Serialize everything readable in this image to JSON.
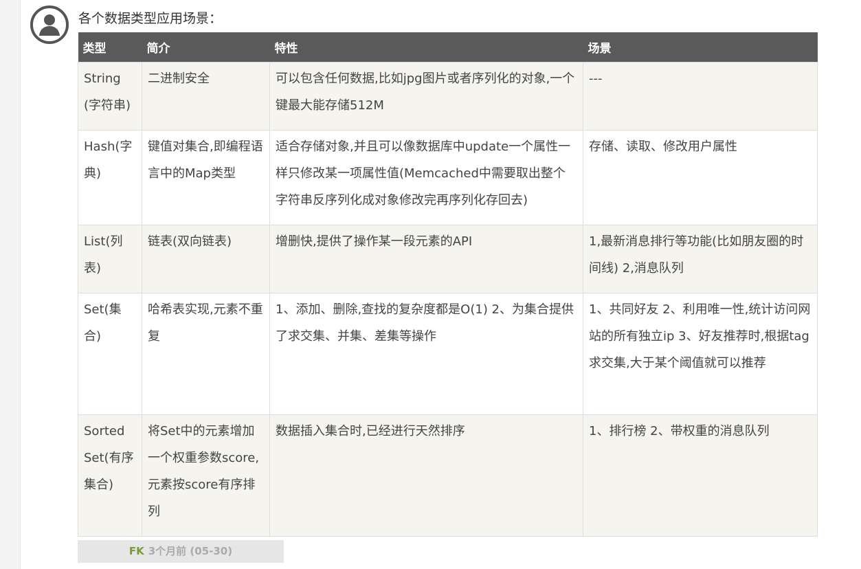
{
  "post": {
    "intro": "各个数据类型应用场景：",
    "avatar_icon": "user-avatar-icon"
  },
  "table": {
    "headers": [
      "类型",
      "简介",
      "特性",
      "场景"
    ],
    "rows": [
      {
        "type": "String(字符串)",
        "intro": "二进制安全",
        "feature": "可以包含任何数据,比如jpg图片或者序列化的对象,一个键最大能存储512M",
        "scene": "---"
      },
      {
        "type": "Hash(字典)",
        "intro": "键值对集合,即编程语言中的Map类型",
        "feature": "适合存储对象,并且可以像数据库中update一个属性一样只修改某一项属性值(Memcached中需要取出整个字符串反序列化成对象修改完再序列化存回去)",
        "scene": "存储、读取、修改用户属性"
      },
      {
        "type": "List(列表)",
        "intro": "链表(双向链表)",
        "feature": "增删快,提供了操作某一段元素的API",
        "scene": "1,最新消息排行等功能(比如朋友圈的时间线) 2,消息队列"
      },
      {
        "type": "Set(集合)",
        "intro": "哈希表实现,元素不重复",
        "feature": "1、添加、删除,查找的复杂度都是O(1) 2、为集合提供了求交集、并集、差集等操作",
        "scene": "1、共同好友 2、利用唯一性,统计访问网站的所有独立ip 3、好友推荐时,根据tag求交集,大于某个阈值就可以推荐"
      },
      {
        "type": "Sorted Set(有序集合)",
        "intro": "将Set中的元素增加一个权重参数score,元素按score有序排列",
        "feature": "数据插入集合时,已经进行天然排序",
        "scene": "1、排行榜 2、带权重的消息队列"
      }
    ]
  },
  "meta": {
    "author": "FK",
    "time": "3个月前 (05-30)"
  },
  "colors": {
    "header_bg": "#5a5a5a",
    "odd_row_bg": "#f5f4ef",
    "even_row_bg": "#ffffff",
    "author_green": "#7a9a3a"
  }
}
